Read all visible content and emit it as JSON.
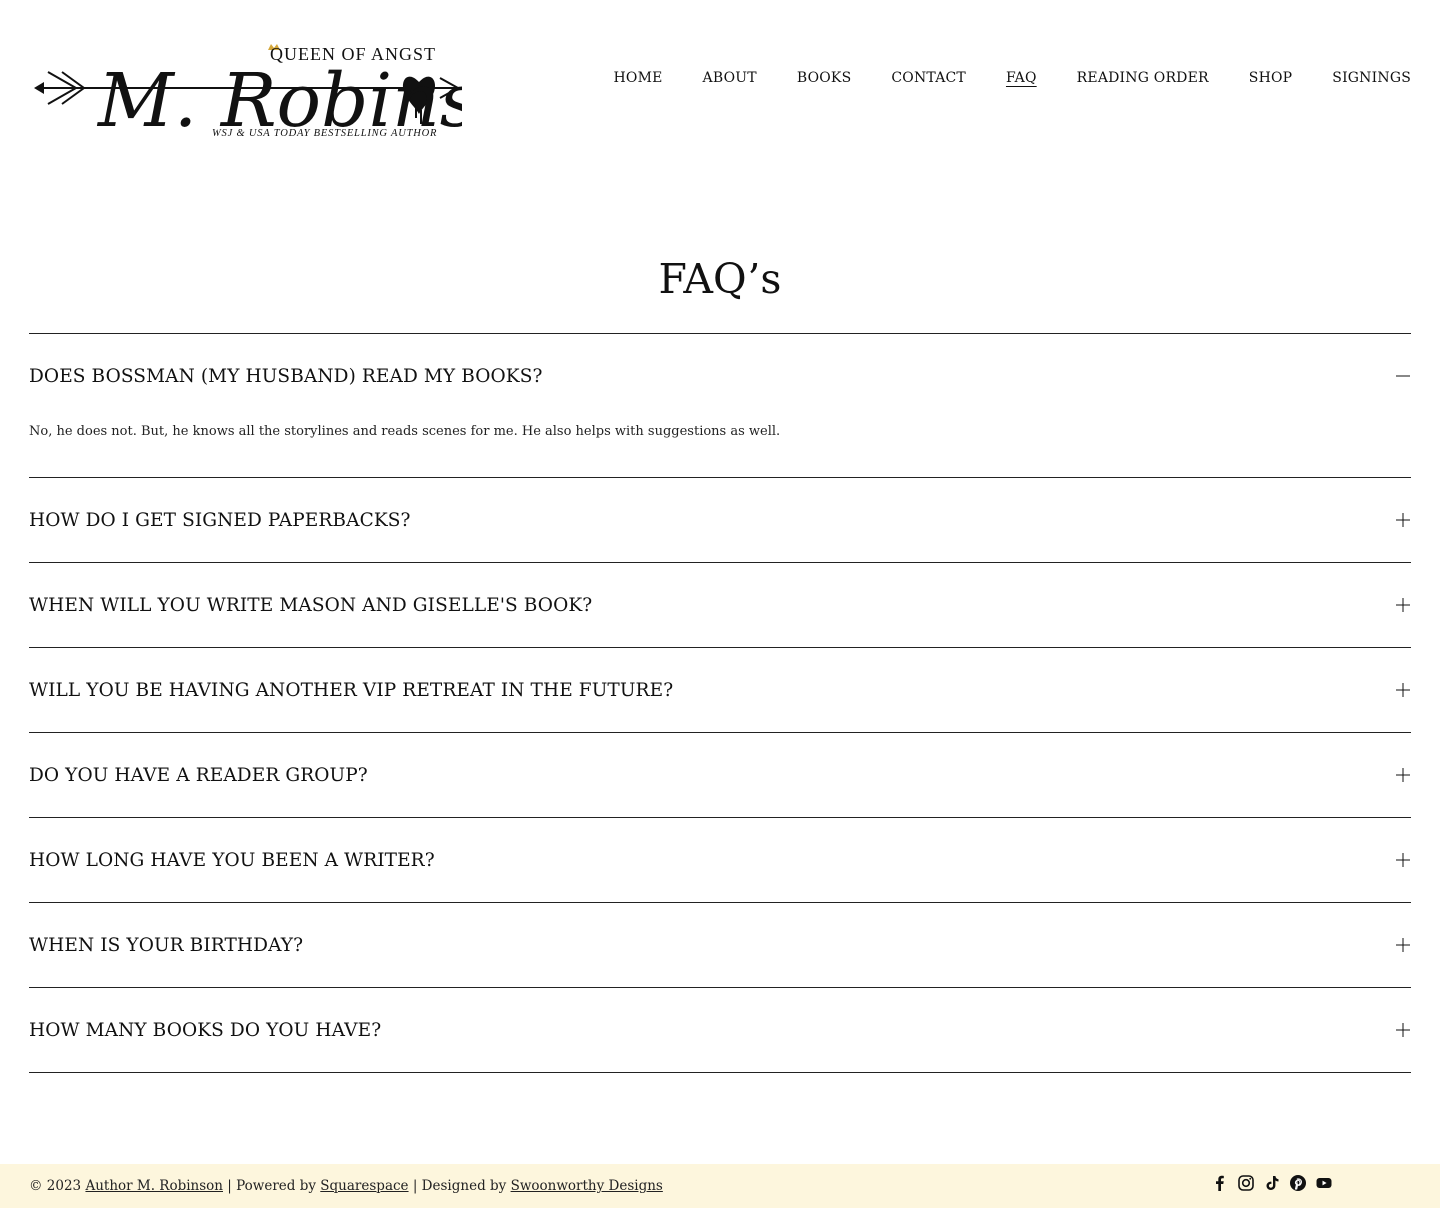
{
  "logo": {
    "name": "M. Robinson",
    "tagline": "QUEEN OF ANGST",
    "subtitle": "WSJ & USA TODAY BESTSELLING AUTHOR"
  },
  "nav": {
    "items": [
      {
        "label": "HOME"
      },
      {
        "label": "ABOUT"
      },
      {
        "label": "BOOKS"
      },
      {
        "label": "CONTACT"
      },
      {
        "label": "FAQ",
        "active": true
      },
      {
        "label": "READING ORDER"
      },
      {
        "label": "SHOP"
      },
      {
        "label": "SIGNINGS"
      }
    ]
  },
  "page": {
    "title": "FAQ’s"
  },
  "faq": {
    "items": [
      {
        "question": "DOES BOSSMAN (MY HUSBAND) READ MY BOOKS?",
        "expanded": true,
        "answer": "No, he does not. But, he knows all the storylines and reads scenes for me. He also helps with suggestions as well."
      },
      {
        "question": "HOW DO I GET SIGNED PAPERBACKS?",
        "expanded": false
      },
      {
        "question": "WHEN WILL YOU WRITE MASON AND GISELLE'S BOOK?",
        "expanded": false
      },
      {
        "question": "WILL YOU BE HAVING ANOTHER VIP RETREAT IN THE FUTURE?",
        "expanded": false
      },
      {
        "question": "DO YOU HAVE A READER GROUP?",
        "expanded": false
      },
      {
        "question": "HOW LONG HAVE YOU BEEN A WRITER?",
        "expanded": false
      },
      {
        "question": "WHEN IS YOUR BIRTHDAY?",
        "expanded": false
      },
      {
        "question": "HOW MANY BOOKS DO YOU HAVE?",
        "expanded": false
      }
    ]
  },
  "footer": {
    "copyright": "© 2023",
    "author_link": "Author M. Robinson",
    "sep1": "| Powered by",
    "powered_link": "Squarespace",
    "sep2": "| Designed by",
    "designer_link": "Swoonworthy Designs",
    "social": [
      "facebook-icon",
      "instagram-icon",
      "tiktok-icon",
      "pinterest-icon",
      "youtube-icon"
    ]
  },
  "colors": {
    "text": "#111111",
    "footer_bg": "#fdf6dd",
    "crown_accent": "#d4a73a"
  }
}
